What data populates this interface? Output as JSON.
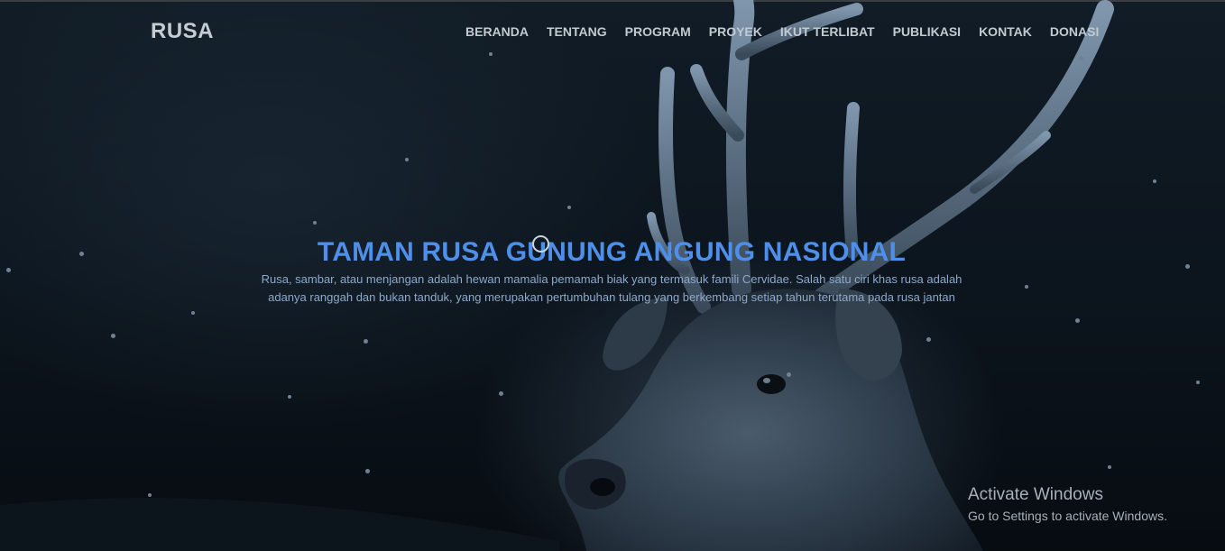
{
  "navbar": {
    "brand": "RUSA",
    "links": [
      "BERANDA",
      "TENTANG",
      "PROGRAM",
      "PROYEK",
      "IKUT TERLIBAT",
      "PUBLIKASI",
      "KONTAK",
      "DONASI"
    ]
  },
  "hero": {
    "title": "TAMAN RUSA GUNUNG ANGUNG NASIONAL",
    "description": "Rusa, sambar, atau menjangan adalah hewan mamalia pemamah biak yang termasuk famili Cervidae. Salah satu ciri khas rusa adalah adanya ranggah dan bukan tanduk, yang merupakan pertumbuhan tulang yang berkembang setiap tahun terutama pada rusa jantan"
  },
  "watermark": {
    "title": "Activate Windows",
    "subtitle": "Go to Settings to activate Windows."
  },
  "colors": {
    "title_accent": "#4e8fea",
    "nav_text": "#c2cad1",
    "background": "#0b1219"
  }
}
